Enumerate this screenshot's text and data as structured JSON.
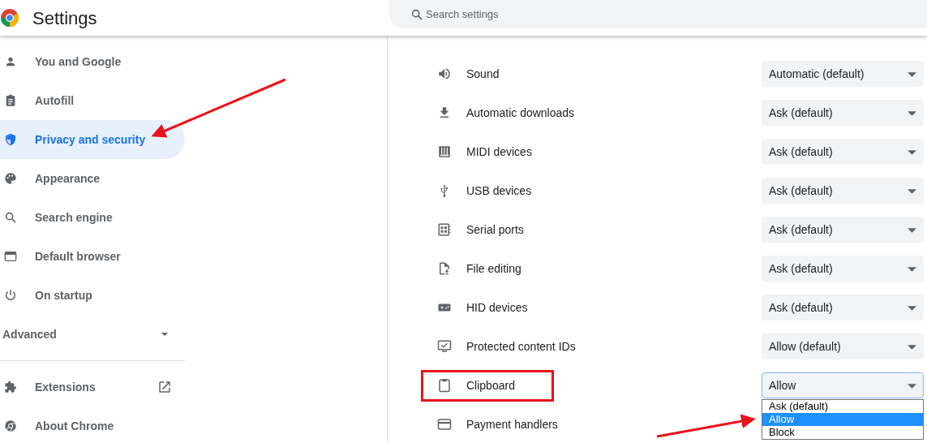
{
  "header": {
    "title": "Settings",
    "search": {
      "placeholder": "Search settings"
    }
  },
  "sidebar": {
    "items": [
      {
        "label": "You and Google",
        "selected": false
      },
      {
        "label": "Autofill",
        "selected": false
      },
      {
        "label": "Privacy and security",
        "selected": true
      },
      {
        "label": "Appearance",
        "selected": false
      },
      {
        "label": "Search engine",
        "selected": false
      },
      {
        "label": "Default browser",
        "selected": false
      },
      {
        "label": "On startup",
        "selected": false
      }
    ],
    "advanced": {
      "label": "Advanced",
      "expanded": false
    },
    "links": [
      {
        "label": "Extensions",
        "external": true
      },
      {
        "label": "About Chrome",
        "external": false
      }
    ]
  },
  "permissions": [
    {
      "label": "Sound",
      "value": "Automatic (default)",
      "highlighted": false
    },
    {
      "label": "Automatic downloads",
      "value": "Ask (default)",
      "highlighted": false
    },
    {
      "label": "MIDI devices",
      "value": "Ask (default)",
      "highlighted": false
    },
    {
      "label": "USB devices",
      "value": "Ask (default)",
      "highlighted": false
    },
    {
      "label": "Serial ports",
      "value": "Ask (default)",
      "highlighted": false
    },
    {
      "label": "File editing",
      "value": "Ask (default)",
      "highlighted": false
    },
    {
      "label": "HID devices",
      "value": "Ask (default)",
      "highlighted": false
    },
    {
      "label": "Protected content IDs",
      "value": "Allow (default)",
      "highlighted": false
    },
    {
      "label": "Clipboard",
      "value": "Allow",
      "highlighted": true,
      "options": [
        {
          "label": "Ask (default)",
          "selected": false
        },
        {
          "label": "Allow",
          "selected": true
        },
        {
          "label": "Block",
          "selected": false
        }
      ]
    },
    {
      "label": "Payment handlers",
      "highlighted": false
    }
  ]
}
